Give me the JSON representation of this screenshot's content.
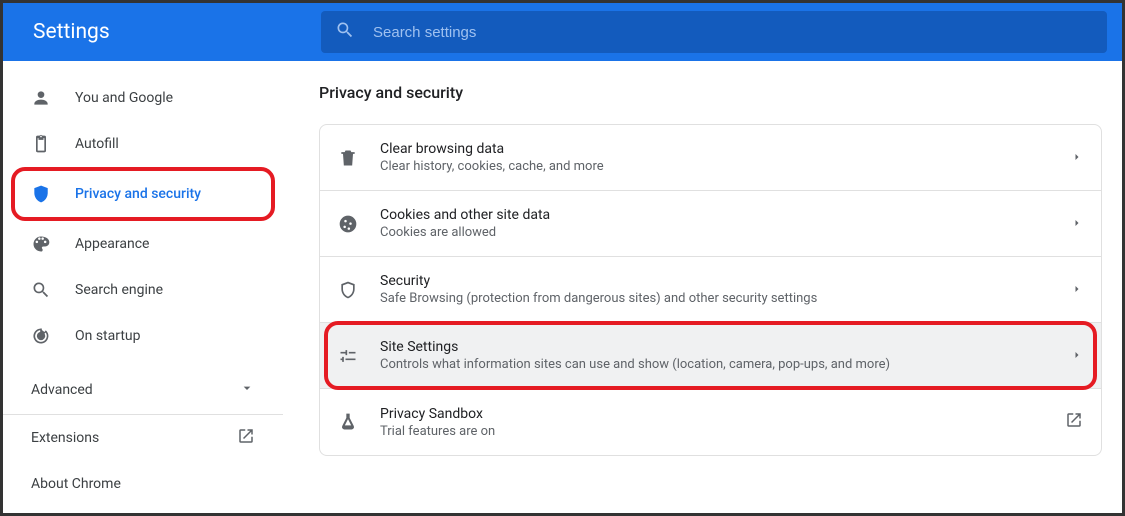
{
  "header": {
    "title": "Settings",
    "search_placeholder": "Search settings"
  },
  "sidebar": {
    "items": [
      {
        "label": "You and Google"
      },
      {
        "label": "Autofill"
      },
      {
        "label": "Privacy and security"
      },
      {
        "label": "Appearance"
      },
      {
        "label": "Search engine"
      },
      {
        "label": "On startup"
      }
    ],
    "advanced_label": "Advanced",
    "extensions_label": "Extensions",
    "about_label": "About Chrome"
  },
  "section": {
    "title": "Privacy and security",
    "rows": [
      {
        "title": "Clear browsing data",
        "sub": "Clear history, cookies, cache, and more"
      },
      {
        "title": "Cookies and other site data",
        "sub": "Cookies are allowed"
      },
      {
        "title": "Security",
        "sub": "Safe Browsing (protection from dangerous sites) and other security settings"
      },
      {
        "title": "Site Settings",
        "sub": "Controls what information sites can use and show (location, camera, pop-ups, and more)"
      },
      {
        "title": "Privacy Sandbox",
        "sub": "Trial features are on"
      }
    ]
  }
}
